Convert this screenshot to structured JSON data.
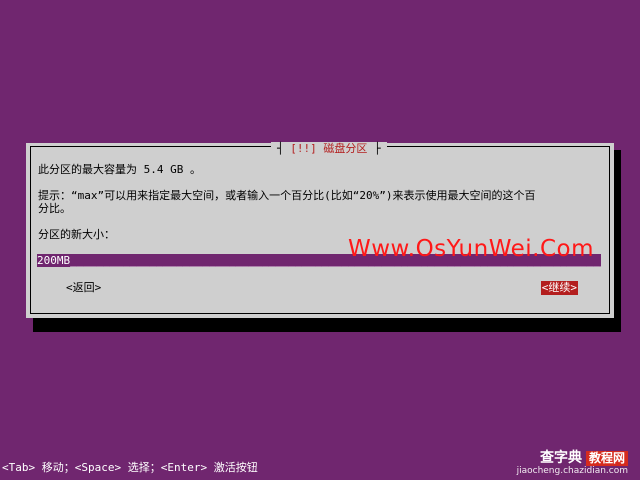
{
  "dialog": {
    "title": "[!!] 磁盘分区",
    "line1": "此分区的最大容量为 5.4 GB 。",
    "hint_line1": "提示：“max”可以用来指定最大空间，或者输入一个百分比(比如“20%”)来表示使用最大空间的这个百",
    "hint_line2": "分比。",
    "prompt": "分区的新大小：",
    "input_value": "200MB",
    "back_button": "<返回>",
    "continue_button": "<继续>"
  },
  "watermark": "Www.OsYunWei.Com",
  "footer": {
    "help": "<Tab> 移动；<Space> 选择；<Enter> 激活按钮"
  },
  "site_logo": {
    "brand": "查字典",
    "tag": "教程网",
    "url": "jiaocheng.chazidian.com"
  },
  "colors": {
    "background": "#70266f",
    "dialog": "#cfcfcf",
    "accent_red": "#b31e1e",
    "watermark": "#ff1818"
  }
}
